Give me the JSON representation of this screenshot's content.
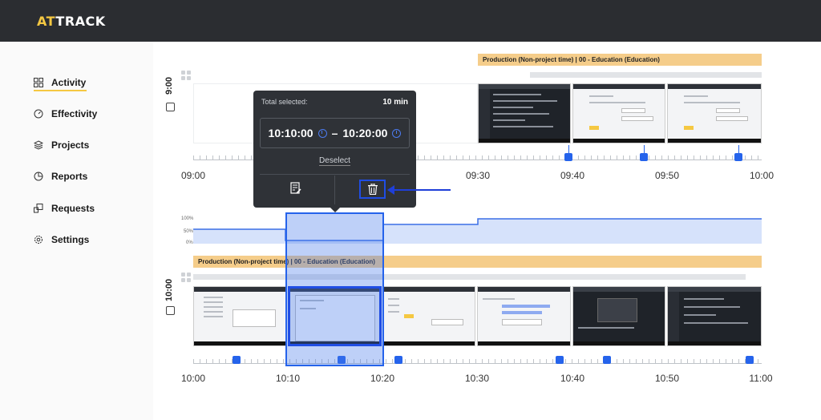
{
  "app": {
    "logo_a": "AT",
    "logo_b": "TRACK"
  },
  "sidebar": {
    "items": [
      {
        "label": "Activity",
        "icon": "grid-icon",
        "active": true
      },
      {
        "label": "Effectivity",
        "icon": "gauge-icon"
      },
      {
        "label": "Projects",
        "icon": "layers-icon"
      },
      {
        "label": "Reports",
        "icon": "pie-chart-icon"
      },
      {
        "label": "Requests",
        "icon": "requests-icon"
      },
      {
        "label": "Settings",
        "icon": "gear-icon"
      }
    ]
  },
  "colors": {
    "accent": "#f5c842",
    "selection": "#2563eb",
    "project_bar": "#f5cd8a",
    "popup_bg": "#2f3237"
  },
  "timeline_9": {
    "hour": "9:00",
    "project_label": "Production (Non-project time) | 00 - Education (Education)",
    "times": [
      "09:00",
      "09:30",
      "09:40",
      "09:50",
      "10:00"
    ]
  },
  "timeline_10": {
    "hour": "10:00",
    "project_label": "Production (Non-project time) | 00 - Education (Education)",
    "times": [
      "10:00",
      "10:10",
      "10:20",
      "10:30",
      "10:40",
      "10:50",
      "11:00"
    ],
    "activity_levels": [
      "100%",
      "50%",
      "0%"
    ]
  },
  "popup": {
    "total_label": "Total selected:",
    "total_value": "10 min",
    "start": "10:10:00",
    "separator": "–",
    "end": "10:20:00",
    "deselect": "Deselect"
  }
}
